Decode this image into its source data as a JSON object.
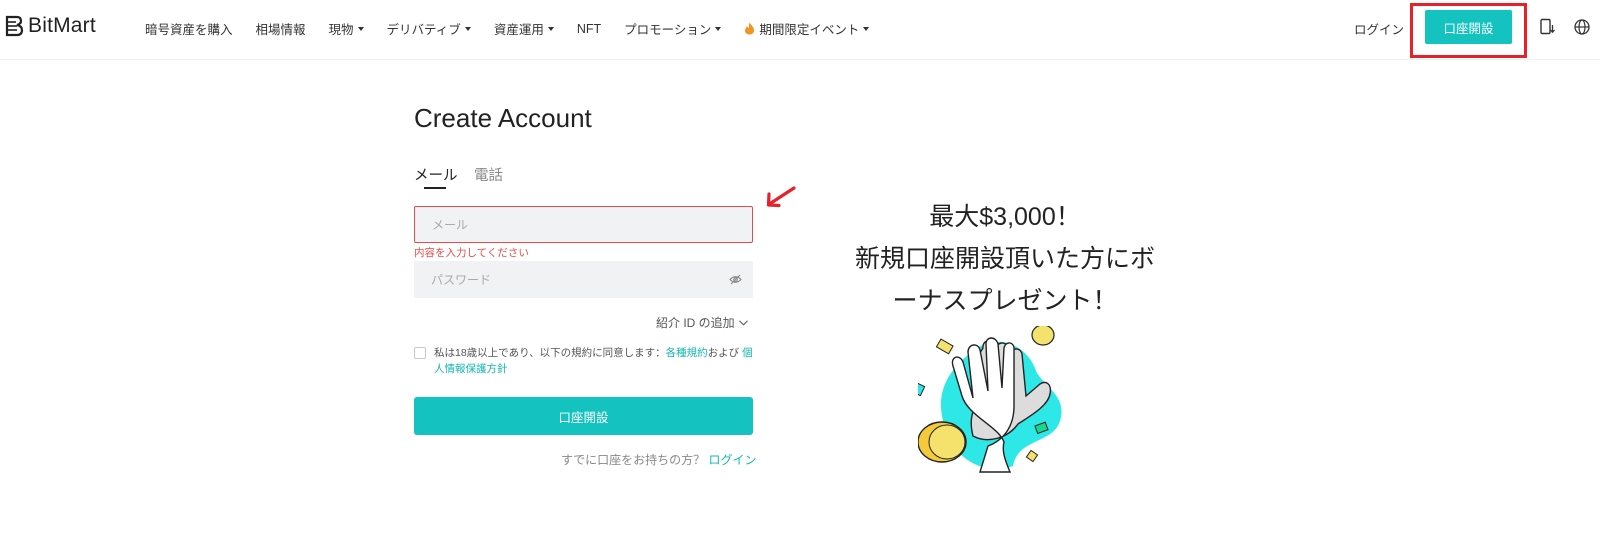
{
  "header": {
    "brand": "BitMart",
    "nav": [
      {
        "label": "暗号資産を購入",
        "dropdown": false
      },
      {
        "label": "相場情報",
        "dropdown": false
      },
      {
        "label": "現物",
        "dropdown": true
      },
      {
        "label": "デリバティブ",
        "dropdown": true
      },
      {
        "label": "資産運用",
        "dropdown": true
      },
      {
        "label": "NFT",
        "dropdown": false
      },
      {
        "label": "プロモーション",
        "dropdown": true
      },
      {
        "label": "期間限定イベント",
        "dropdown": true,
        "icon": "flame-icon"
      }
    ],
    "login": "ログイン",
    "signup": "口座開設",
    "icons": [
      "download-app-icon",
      "globe-icon"
    ]
  },
  "form": {
    "title": "Create Account",
    "tabs": [
      {
        "label": "メール",
        "active": true
      },
      {
        "label": "電話",
        "active": false
      }
    ],
    "email_placeholder": "メール",
    "email_error": "内容を入力してください",
    "password_placeholder": "パスワード",
    "referral": "紹介 ID の追加",
    "terms_prefix": "私は18歳以上であり、以下の規約に同意します：",
    "terms_link": "各種規約",
    "terms_and": "および",
    "privacy_link": "個人情報保護方針",
    "submit": "口座開設",
    "have_account": "すでに口座をお持ちの方？",
    "login_link": "ログイン"
  },
  "promo": {
    "lines": [
      "最大$3,000！",
      "新規口座開設頂いた方にボ",
      "ーナスプレゼント！"
    ]
  },
  "colors": {
    "accent": "#14c3bf",
    "error": "#e94b4b",
    "annotation": "#e8202a"
  }
}
